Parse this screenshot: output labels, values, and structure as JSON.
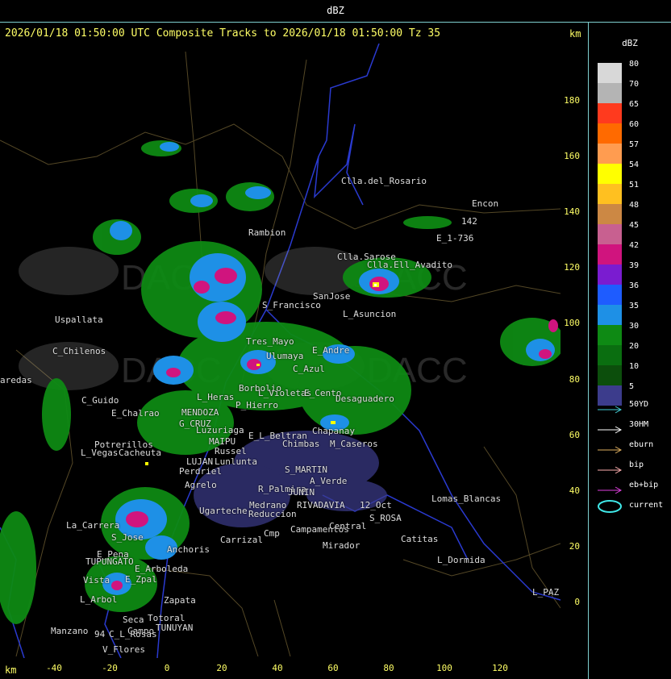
{
  "window_title": "dBZ",
  "header": "2026/01/18 01:50:00 UTC Composite Tracks to 2026/01/18 01:50:00 Tz 35",
  "axis_unit_top": "km",
  "axis_unit_bottom": "km",
  "y_ticks": [
    "180",
    "160",
    "140",
    "120",
    "100",
    "80",
    "60",
    "40",
    "20",
    "0"
  ],
  "x_ticks": [
    "-40",
    "-20",
    "0",
    "20",
    "40",
    "60",
    "80",
    "100",
    "120"
  ],
  "legend": {
    "title": "dBZ",
    "levels": [
      {
        "label": "80",
        "color": "#d8d8d8"
      },
      {
        "label": "70",
        "color": "#b4b4b4"
      },
      {
        "label": "65",
        "color": "#ff3a1e"
      },
      {
        "label": "60",
        "color": "#ff6a00"
      },
      {
        "label": "57",
        "color": "#ff9c50"
      },
      {
        "label": "54",
        "color": "#ffff00"
      },
      {
        "label": "51",
        "color": "#ffc020"
      },
      {
        "label": "48",
        "color": "#cc8844"
      },
      {
        "label": "45",
        "color": "#c86090"
      },
      {
        "label": "42",
        "color": "#d0147e"
      },
      {
        "label": "39",
        "color": "#7a1cd0"
      },
      {
        "label": "36",
        "color": "#1e5cff"
      },
      {
        "label": "35",
        "color": "#1e90e6"
      },
      {
        "label": "30",
        "color": "#0e8a14"
      },
      {
        "label": "20",
        "color": "#0a6e10"
      },
      {
        "label": "10",
        "color": "#0c4e0c"
      },
      {
        "label": "5",
        "color": "#3c3c8c"
      }
    ],
    "tracks": [
      {
        "label": "50YD",
        "color": "#44d0d8",
        "type": "arrow"
      },
      {
        "label": "30HM",
        "color": "#ffffff",
        "type": "arrow"
      },
      {
        "label": "eburn",
        "color": "#e0b060",
        "type": "arrow"
      },
      {
        "label": "bip",
        "color": "#ffb0b0",
        "type": "arrow"
      },
      {
        "label": "eb+bip",
        "color": "#e040e0",
        "type": "arrow"
      },
      {
        "label": "current",
        "color": "#40e8e8",
        "type": "ellipse"
      }
    ]
  },
  "places": [
    {
      "name": "Clla.del_Rosario"
    },
    {
      "name": "Encon"
    },
    {
      "name": "142"
    },
    {
      "name": "E_1-736"
    },
    {
      "name": "Rambion"
    },
    {
      "name": "Clla.Sarose"
    },
    {
      "name": "Clla.Ell_Avadito"
    },
    {
      "name": "Uspallata"
    },
    {
      "name": "S_Francisco"
    },
    {
      "name": "SanJose"
    },
    {
      "name": "L_Asuncion"
    },
    {
      "name": "C_Chilenos"
    },
    {
      "name": "Tres_Mayo"
    },
    {
      "name": "Ulumaya"
    },
    {
      "name": "E_Andre"
    },
    {
      "name": "aredas"
    },
    {
      "name": "Borbolio"
    },
    {
      "name": "C_Azul"
    },
    {
      "name": "L_Violetas"
    },
    {
      "name": "E_Cento"
    },
    {
      "name": "C_Guido"
    },
    {
      "name": "L_Heras"
    },
    {
      "name": "P_Hierro"
    },
    {
      "name": "Desaguadero"
    },
    {
      "name": "E_Chalrao"
    },
    {
      "name": "MENDOZA"
    },
    {
      "name": "G_CRUZ"
    },
    {
      "name": "Luzuriaga"
    },
    {
      "name": "E_L_Beltran"
    },
    {
      "name": "Chapanay"
    },
    {
      "name": "Potrerillos"
    },
    {
      "name": "MAIPU"
    },
    {
      "name": "Russel"
    },
    {
      "name": "Chimbas"
    },
    {
      "name": "M_Caseros"
    },
    {
      "name": "L_Vegas"
    },
    {
      "name": "Cacheuta"
    },
    {
      "name": "LUJAN"
    },
    {
      "name": "Lunlunta"
    },
    {
      "name": "Perdriel"
    },
    {
      "name": "S_MARTIN"
    },
    {
      "name": "Agrelo"
    },
    {
      "name": "R_Palmira"
    },
    {
      "name": "JUNIN"
    },
    {
      "name": "A_Verde"
    },
    {
      "name": "Ugarteche"
    },
    {
      "name": "Medrano"
    },
    {
      "name": "Reduccion"
    },
    {
      "name": "RIVADAVIA"
    },
    {
      "name": "12_Oct"
    },
    {
      "name": "Lomas_Blancas"
    },
    {
      "name": "S_ROSA"
    },
    {
      "name": "La_Carrera"
    },
    {
      "name": "S_Jose"
    },
    {
      "name": "Carrizal"
    },
    {
      "name": "Campamentos"
    },
    {
      "name": "Central"
    },
    {
      "name": "Catitas"
    },
    {
      "name": "E_Pena"
    },
    {
      "name": "TUPUNGATO"
    },
    {
      "name": "Anchoris"
    },
    {
      "name": "Mirador"
    },
    {
      "name": "L_Dormida"
    },
    {
      "name": "E_Arboleda"
    },
    {
      "name": "E_Zpal"
    },
    {
      "name": "Vista"
    },
    {
      "name": "L_Arbol"
    },
    {
      "name": "Zapata"
    },
    {
      "name": "L_PAZ"
    },
    {
      "name": "Manzano"
    },
    {
      "name": "Campo"
    },
    {
      "name": "Seca"
    },
    {
      "name": "Totoral"
    },
    {
      "name": "TUNUYAN"
    },
    {
      "name": "94"
    },
    {
      "name": "C_L_Rosas"
    },
    {
      "name": "V_Flores"
    },
    {
      "name": "Cmp"
    }
  ]
}
